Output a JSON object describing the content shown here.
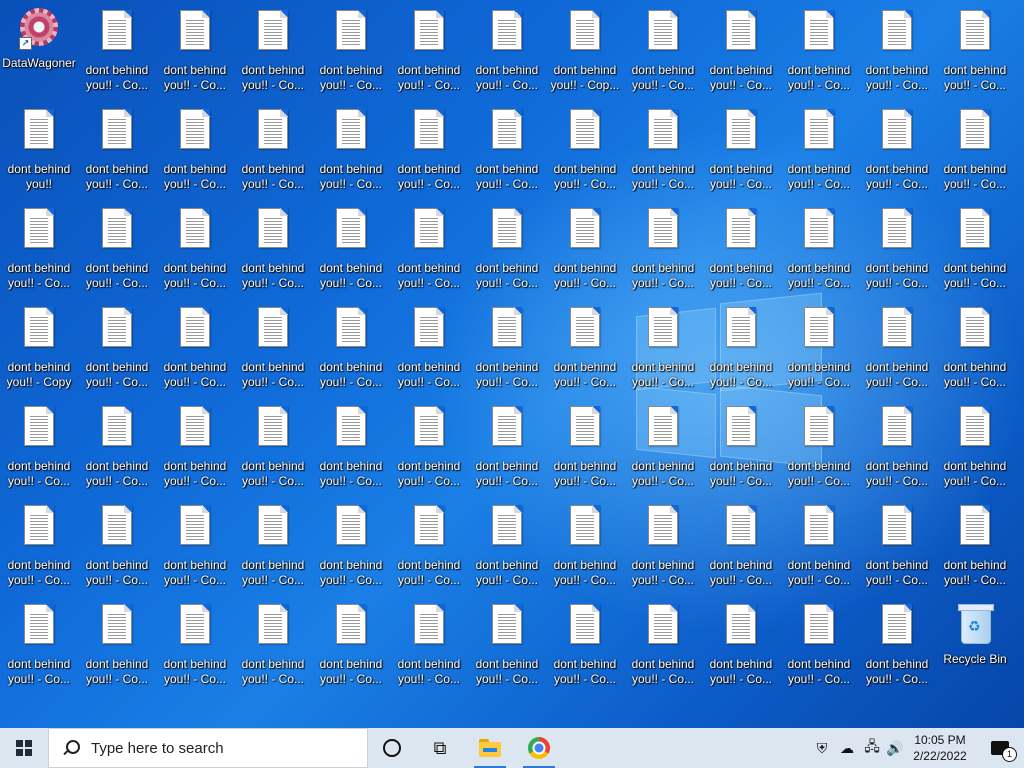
{
  "desktop": {
    "app_shortcut_label": "DataWagoner",
    "file_label_original": "dont behind you!!",
    "file_label_copy": "dont behind you!! - Copy",
    "file_label_copy_truncated": "dont behind you!! - Co...",
    "file_label_copy_truncated_alt": "dont behind you!! - Cop...",
    "recycle_bin_label": "Recycle Bin"
  },
  "taskbar": {
    "search_placeholder": "Type here to search",
    "time": "10:05 PM",
    "date": "2/22/2022",
    "notification_count": "1"
  },
  "icons": {
    "file": "text-document-icon",
    "app": "gear-icon",
    "recycle": "recycle-bin-icon",
    "start": "windows-logo-icon",
    "search": "search-icon",
    "cortana": "cortana-circle-icon",
    "taskview": "task-view-icon",
    "explorer": "folder-icon",
    "browser": "chrome-icon",
    "security": "shield-icon",
    "network_offline": "cloud-offline-icon",
    "network": "network-icon",
    "volume": "speaker-icon",
    "action_center": "notification-icon"
  },
  "colors": {
    "desktop_base": "#0f6ad8",
    "taskbar_bg": "#dce6f0",
    "label_text": "#ffffff"
  }
}
